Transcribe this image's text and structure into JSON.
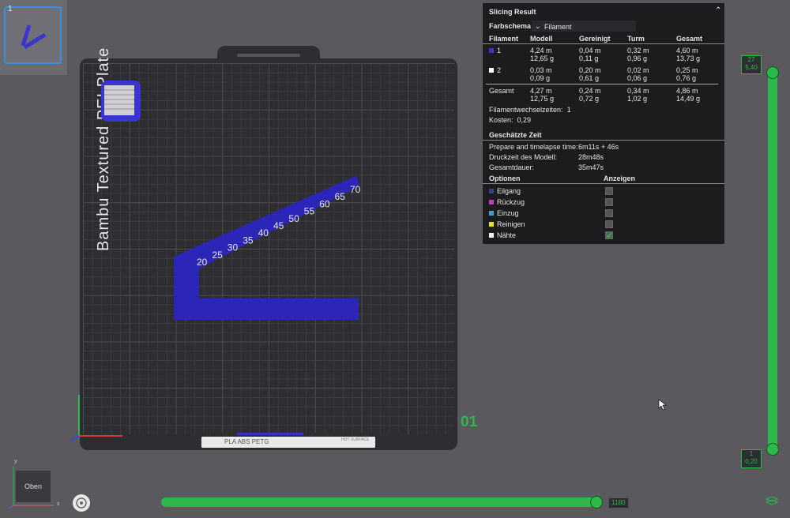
{
  "thumbnail": {
    "number": "1"
  },
  "plate": {
    "label": "Bambu Textured PEI Plate",
    "number": "01",
    "strip_text": "PLA ABS PETG",
    "strip_text2": "HOT SURFACE",
    "step_labels": [
      "20",
      "25",
      "30",
      "35",
      "40",
      "45",
      "50",
      "55",
      "60",
      "65",
      "70"
    ]
  },
  "colors": {
    "accent": "#2db84c",
    "model": "#2b26b8",
    "panel_bg": "#1c1c1e"
  },
  "slicing_result": {
    "title": "Slicing Result",
    "color_scheme_label": "Farbschema",
    "color_scheme_value": "Filament",
    "columns": [
      "Filament",
      "Modell",
      "Gereinigt",
      "Turm",
      "Gesamt"
    ],
    "filaments": [
      {
        "id": "1",
        "color": "#3b2fd6",
        "modell": [
          "4,24 m",
          "12,65 g"
        ],
        "gereinigt": [
          "0,04 m",
          "0,11 g"
        ],
        "turm": [
          "0,32 m",
          "0,96 g"
        ],
        "gesamt": [
          "4,60 m",
          "13,73 g"
        ]
      },
      {
        "id": "2",
        "color": "#ffffff",
        "modell": [
          "0,03 m",
          "0,09 g"
        ],
        "gereinigt": [
          "0,20 m",
          "0,61 g"
        ],
        "turm": [
          "0,02 m",
          "0,06 g"
        ],
        "gesamt": [
          "0,25 m",
          "0,76 g"
        ]
      }
    ],
    "total": {
      "label": "Gesamt",
      "modell": [
        "4,27 m",
        "12,75 g"
      ],
      "gereinigt": [
        "0,24 m",
        "0,72 g"
      ],
      "turm": [
        "0,34 m",
        "1,02 g"
      ],
      "gesamt": [
        "4,86 m",
        "14,49 g"
      ]
    },
    "filament_changes_label": "Filamentwechselzeiten:",
    "filament_changes_value": "1",
    "cost_label": "Kosten:",
    "cost_value": "0,29",
    "time_title": "Geschätzte Zeit",
    "times": [
      {
        "label": "Prepare and timelapse time:",
        "value": "6m11s + 46s"
      },
      {
        "label": "Druckzeit des Modell:",
        "value": "28m48s"
      },
      {
        "label": "Gesamtdauer:",
        "value": "35m47s"
      }
    ],
    "options_header": "Optionen",
    "show_header": "Anzeigen",
    "options": [
      {
        "label": "Eilgang",
        "color": "#3a3f8a",
        "checked": false
      },
      {
        "label": "Rückzug",
        "color": "#c03ac4",
        "checked": false
      },
      {
        "label": "Einzug",
        "color": "#3aa2c4",
        "checked": false
      },
      {
        "label": "Reinigen",
        "color": "#e6e21a",
        "checked": false
      },
      {
        "label": "Nähte",
        "color": "#f0f0f0",
        "checked": true
      }
    ]
  },
  "layer_slider": {
    "top_layer": "27",
    "top_height": "5,40",
    "bottom_layer": "1",
    "bottom_height": "0,20"
  },
  "move_slider": {
    "value": "1180"
  },
  "view": {
    "label": "Oben"
  },
  "axes": {
    "x": "x",
    "y": "y"
  }
}
